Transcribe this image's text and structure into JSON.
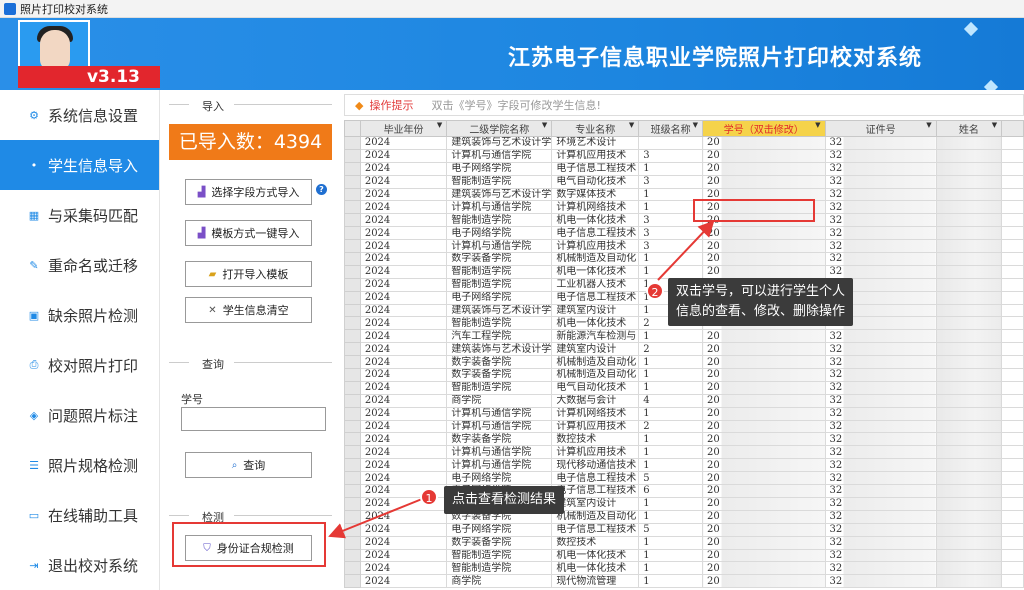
{
  "window": {
    "title": "照片打印校对系统"
  },
  "header": {
    "title": "江苏电子信息职业学院照片打印校对系统",
    "version": "v3.13"
  },
  "sidebar": {
    "items": [
      {
        "label": "系统信息设置",
        "icon": "gear-icon"
      },
      {
        "label": "学生信息导入",
        "icon": "dot-icon",
        "active": true
      },
      {
        "label": "与采集码匹配",
        "icon": "grid-icon"
      },
      {
        "label": "重命名或迁移",
        "icon": "edit-icon"
      },
      {
        "label": "缺余照片检测",
        "icon": "photo-icon"
      },
      {
        "label": "校对照片打印",
        "icon": "printer-icon"
      },
      {
        "label": "问题照片标注",
        "icon": "tag-icon"
      },
      {
        "label": "照片规格检测",
        "icon": "list-icon"
      },
      {
        "label": "在线辅助工具",
        "icon": "monitor-icon"
      },
      {
        "label": "退出校对系统",
        "icon": "exit-icon"
      }
    ]
  },
  "panel": {
    "import_label": "导入",
    "count_text": "已导入数：4394",
    "btn_field_import": "选择字段方式导入",
    "btn_template_import": "模板方式一键导入",
    "btn_open_template": "打开导入模板",
    "btn_clear": "学生信息清空",
    "query_label": "查询",
    "student_id_label": "学号",
    "student_id_value": "",
    "btn_query": "查询",
    "detect_label": "检测",
    "btn_id_check": "身份证合规检测"
  },
  "hint": {
    "title": "操作提示",
    "message": "双击《学号》字段可修改学生信息!"
  },
  "table": {
    "columns": [
      "毕业年份",
      "二级学院名称",
      "专业名称",
      "班级名称",
      "学号（双击修改）",
      "证件号",
      "姓名"
    ],
    "rows": [
      [
        "2024",
        "建筑装饰与艺术设计学",
        "环境艺术设计",
        "",
        "20",
        "32",
        ""
      ],
      [
        "2024",
        "计算机与通信学院",
        "计算机应用技术",
        "3",
        "20",
        "32",
        ""
      ],
      [
        "2024",
        "电子网络学院",
        "电子信息工程技术",
        "1",
        "20",
        "32",
        ""
      ],
      [
        "2024",
        "智能制造学院",
        "电气自动化技术",
        "3",
        "20",
        "32",
        ""
      ],
      [
        "2024",
        "建筑装饰与艺术设计学",
        "数字媒体技术",
        "1",
        "20",
        "32",
        ""
      ],
      [
        "2024",
        "计算机与通信学院",
        "计算机网络技术",
        "1",
        "20",
        "32",
        ""
      ],
      [
        "2024",
        "智能制造学院",
        "机电一体化技术",
        "3",
        "20",
        "32",
        ""
      ],
      [
        "2024",
        "电子网络学院",
        "电子信息工程技术",
        "3",
        "20",
        "32",
        ""
      ],
      [
        "2024",
        "计算机与通信学院",
        "计算机应用技术",
        "3",
        "20",
        "32",
        ""
      ],
      [
        "2024",
        "数字装备学院",
        "机械制造及自动化",
        "1",
        "20",
        "32",
        ""
      ],
      [
        "2024",
        "智能制造学院",
        "机电一体化技术",
        "1",
        "20",
        "32",
        ""
      ],
      [
        "2024",
        "智能制造学院",
        "工业机器人技术",
        "1",
        "20",
        "32",
        ""
      ],
      [
        "2024",
        "电子网络学院",
        "电子信息工程技术",
        "1",
        "20",
        "32",
        ""
      ],
      [
        "2024",
        "建筑装饰与艺术设计学",
        "建筑室内设计",
        "1",
        "20",
        "32",
        ""
      ],
      [
        "2024",
        "智能制造学院",
        "机电一体化技术",
        "2",
        "20",
        "32",
        ""
      ],
      [
        "2024",
        "汽车工程学院",
        "新能源汽车检测与",
        "1",
        "20",
        "32",
        ""
      ],
      [
        "2024",
        "建筑装饰与艺术设计学",
        "建筑室内设计",
        "2",
        "20",
        "32",
        ""
      ],
      [
        "2024",
        "数字装备学院",
        "机械制造及自动化",
        "1",
        "20",
        "32",
        ""
      ],
      [
        "2024",
        "数字装备学院",
        "机械制造及自动化",
        "1",
        "20",
        "32",
        ""
      ],
      [
        "2024",
        "智能制造学院",
        "电气自动化技术",
        "1",
        "20",
        "32",
        ""
      ],
      [
        "2024",
        "商学院",
        "大数据与会计",
        "4",
        "20",
        "32",
        ""
      ],
      [
        "2024",
        "计算机与通信学院",
        "计算机网络技术",
        "1",
        "20",
        "32",
        ""
      ],
      [
        "2024",
        "计算机与通信学院",
        "计算机应用技术",
        "2",
        "20",
        "32",
        ""
      ],
      [
        "2024",
        "数字装备学院",
        "数控技术",
        "1",
        "20",
        "32",
        ""
      ],
      [
        "2024",
        "计算机与通信学院",
        "计算机应用技术",
        "1",
        "20",
        "32",
        ""
      ],
      [
        "2024",
        "计算机与通信学院",
        "现代移动通信技术",
        "1",
        "20",
        "32",
        ""
      ],
      [
        "2024",
        "电子网络学院",
        "电子信息工程技术",
        "5",
        "20",
        "32",
        ""
      ],
      [
        "2024",
        "电子网络学院",
        "电子信息工程技术",
        "6",
        "20",
        "32",
        ""
      ],
      [
        "2024",
        "建筑装饰与艺术设计学",
        "建筑室内设计",
        "1",
        "20",
        "32",
        ""
      ],
      [
        "2024",
        "数字装备学院",
        "机械制造及自动化",
        "1",
        "20",
        "32",
        ""
      ],
      [
        "2024",
        "电子网络学院",
        "电子信息工程技术",
        "5",
        "20",
        "32",
        ""
      ],
      [
        "2024",
        "数字装备学院",
        "数控技术",
        "1",
        "20",
        "32",
        ""
      ],
      [
        "2024",
        "智能制造学院",
        "机电一体化技术",
        "1",
        "20",
        "32",
        ""
      ],
      [
        "2024",
        "智能制造学院",
        "机电一体化技术",
        "1",
        "20",
        "32",
        ""
      ],
      [
        "2024",
        "商学院",
        "现代物流管理",
        "1",
        "20",
        "32",
        ""
      ]
    ]
  },
  "callouts": {
    "one_number": "1",
    "one_text": "点击查看检测结果",
    "two_number": "2",
    "two_line1": "双击学号，可以进行学生个人",
    "two_line2": "信息的查看、修改、删除操作"
  },
  "colors": {
    "primary": "#1f8ae6",
    "accent_orange": "#f07a18",
    "version_red": "#e2262d",
    "annotation_red": "#e53935"
  }
}
